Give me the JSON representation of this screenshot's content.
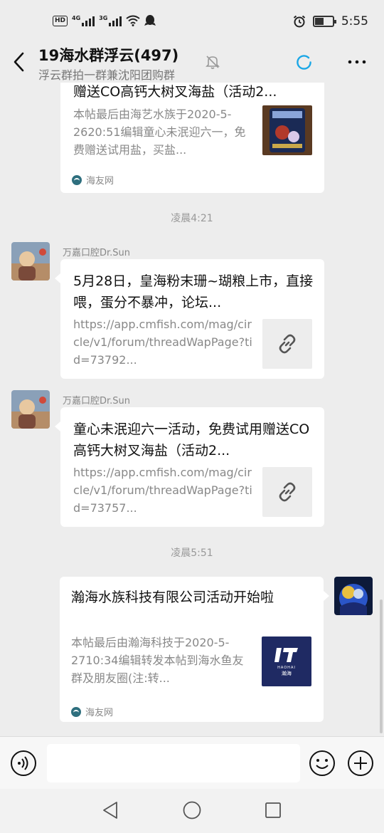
{
  "status_bar": {
    "hd": "HD",
    "sim1_type": "4G",
    "sim2_type": "3G",
    "time": "5:55"
  },
  "header": {
    "title": "19海水群浮云(497)",
    "subtitle": "浮云群拍一群兼沈阳团购群"
  },
  "messages": {
    "card0": {
      "title": "赠送CO高钙大树叉海盐（活动2...",
      "desc": "本帖最后由海艺水族于2020-5-2620:51编辑童心未泯迎六一，免费赠送试用盐，买盐...",
      "source": "海友网"
    },
    "time1": "凌晨4:21",
    "msg1": {
      "sender": "万嘉口腔Dr.Sun",
      "title": "5月28日，皇海粉末珊~瑚粮上市，直接喂，蛋分不暴冲，论坛...",
      "url": "https://app.cmfish.com/mag/circle/v1/forum/threadWapPage?tid=73792..."
    },
    "msg2": {
      "sender": "万嘉口腔Dr.Sun",
      "title": "童心未泯迎六一活动，免费试用赠送CO高钙大树叉海盐（活动2...",
      "url": "https://app.cmfish.com/mag/circle/v1/forum/threadWapPage?tid=73757..."
    },
    "time2": "凌晨5:51",
    "msg3": {
      "title": "瀚海水族科技有限公司活动开始啦",
      "desc": "本帖最后由瀚海科技于2020-5-2710:34编辑转发本帖到海水鱼友群及朋友圈(注:转...",
      "source": "海友网",
      "logo_sub": "HAOHAI",
      "logo_cn": "瀚海"
    }
  },
  "input": {
    "placeholder": ""
  },
  "colors": {
    "background": "#ededed",
    "bubble": "#ffffff",
    "spinner": "#1aa7e6"
  }
}
